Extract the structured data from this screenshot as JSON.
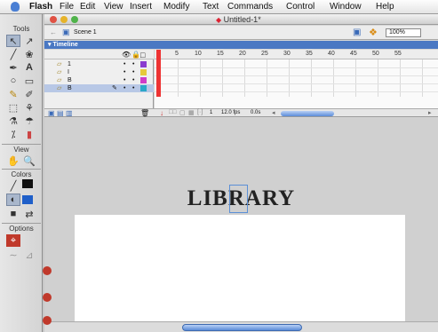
{
  "menubar": {
    "app": "Flash",
    "items": [
      "File",
      "Edit",
      "View",
      "Insert",
      "Modify",
      "Text",
      "Commands",
      "Control",
      "Window",
      "Help"
    ]
  },
  "tools_panel": {
    "tools_label": "Tools",
    "view_label": "View",
    "colors_label": "Colors",
    "options_label": "Options"
  },
  "document": {
    "title": "Untitled-1*",
    "scene": "Scene 1",
    "zoom": "100%"
  },
  "timeline": {
    "title": "Timeline",
    "layers": [
      {
        "name": "1",
        "selected": false
      },
      {
        "name": "I",
        "selected": false
      },
      {
        "name": "B",
        "selected": false
      },
      {
        "name": "B",
        "selected": true
      }
    ],
    "frame_numbers": [
      "5",
      "10",
      "15",
      "20",
      "25",
      "30",
      "35",
      "40",
      "45",
      "50",
      "55"
    ],
    "status": {
      "frame": "1",
      "fps": "12.0 fps",
      "time": "0.0s"
    }
  },
  "stage": {
    "text": "LIBRARY"
  },
  "colors": {
    "accent": "#4a78c3",
    "stage": "#ffffff",
    "work_area": "#d0d0d0"
  }
}
